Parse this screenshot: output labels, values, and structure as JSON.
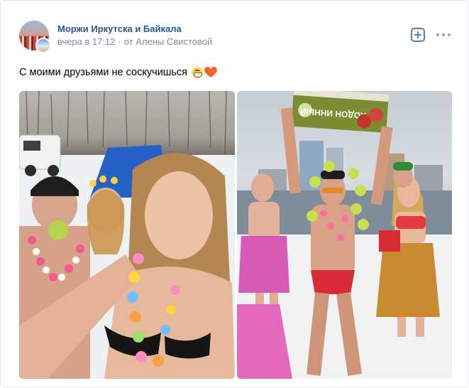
{
  "post": {
    "group_name": "Моржи Иркутска и Байкала",
    "time": "вчера в 17:12",
    "separator": "·",
    "author": "от Алены Свистовой",
    "text": "С моими друзьями не соскучишься",
    "emojis": [
      "grinning-squinting-face",
      "orange-heart"
    ]
  },
  "actions": {
    "add_icon": "plus-square-icon",
    "more_icon": "more-horizontal-icon"
  },
  "photos": [
    {
      "name": "photo-selfie-group-snow"
    },
    {
      "name": "photo-man-holding-box-on-beach",
      "box_text": "ХОДОН ИННЫЙ"
    }
  ],
  "colors": {
    "link": "#2a5885",
    "meta": "#818c99",
    "accent": "#5181b8",
    "icon_gray": "#99a2ad",
    "border": "#e7e8ec"
  }
}
